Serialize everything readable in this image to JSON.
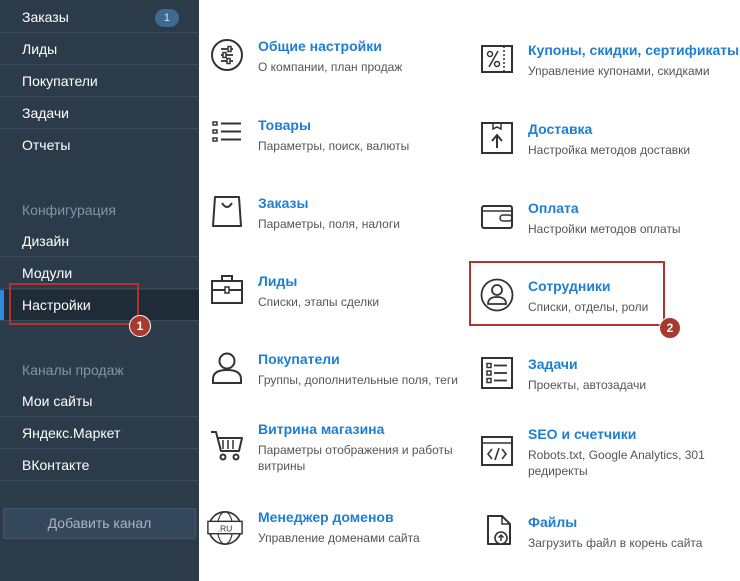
{
  "sidebar": {
    "orders": {
      "label": "Заказы",
      "badge": "1"
    },
    "leads": "Лиды",
    "buyers": "Покупатели",
    "tasks": "Задачи",
    "reports": "Отчеты",
    "config_heading": "Конфигурация",
    "design": "Дизайн",
    "modules": "Модули",
    "settings": "Настройки",
    "channels_heading": "Каналы продаж",
    "my_sites": "Мои сайты",
    "yandex_market": "Яндекс.Маркет",
    "vkontakte": "ВКонтакте",
    "add_channel": "Добавить канал"
  },
  "tiles": {
    "general": {
      "title": "Общие настройки",
      "desc": "О компании, план продаж"
    },
    "coupons": {
      "title": "Купоны, скидки, сертификаты",
      "desc": "Управление купонами, скидками"
    },
    "products": {
      "title": "Товары",
      "desc": "Параметры, поиск, валюты"
    },
    "delivery": {
      "title": "Доставка",
      "desc": "Настройка методов доставки"
    },
    "orders": {
      "title": "Заказы",
      "desc": "Параметры, поля, налоги"
    },
    "payment": {
      "title": "Оплата",
      "desc": "Настройки методов оплаты"
    },
    "leads": {
      "title": "Лиды",
      "desc": "Списки, этапы сделки"
    },
    "staff": {
      "title": "Сотрудники",
      "desc": "Списки, отделы, роли"
    },
    "buyers": {
      "title": "Покупатели",
      "desc": "Группы, дополнительные поля, теги"
    },
    "tasks": {
      "title": "Задачи",
      "desc": "Проекты, автозадачи"
    },
    "storefront": {
      "title": "Витрина магазина",
      "desc1": "Параметры отображения и работы",
      "desc2": "витрины"
    },
    "seo": {
      "title": "SEO и счетчики",
      "desc1": "Robots.txt, Google Analytics, 301",
      "desc2": "редиректы"
    },
    "domains": {
      "title": "Менеджер доменов",
      "desc": "Управление доменами сайта",
      "icon_text": ".RU"
    },
    "files": {
      "title": "Файлы",
      "desc": "Загрузить файл в корень сайта"
    }
  },
  "markers": {
    "m1": "1",
    "m2": "2"
  },
  "colors": {
    "sidebar_bg": "#2b3b4a",
    "link": "#1e7fd1",
    "highlight": "#b3332f",
    "accent": "#2b8be0"
  }
}
